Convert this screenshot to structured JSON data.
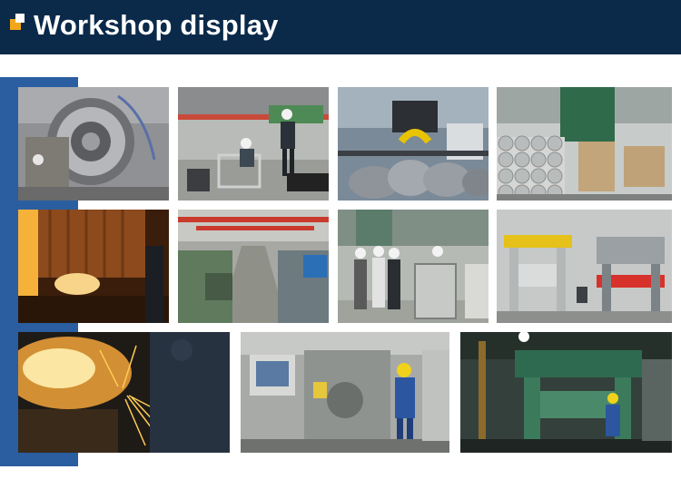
{
  "header": {
    "title": "Workshop display",
    "icon": "stacked-squares-icon"
  },
  "colors": {
    "header_bg": "#0b2a4a",
    "accent_bar": "#2a5ea0",
    "icon_orange": "#f2a71b"
  },
  "gallery": {
    "photos": [
      "fitting-machine-photo",
      "workers-factory-floor-photo",
      "pipe-elbows-photo",
      "stacked-pipes-warehouse-photo",
      "furnace-glow-photo",
      "factory-aisle-photo",
      "inspection-group-photo",
      "hydraulic-presses-photo",
      "cutting-sparks-photo",
      "cnc-operator-photo",
      "large-press-operator-photo"
    ]
  }
}
